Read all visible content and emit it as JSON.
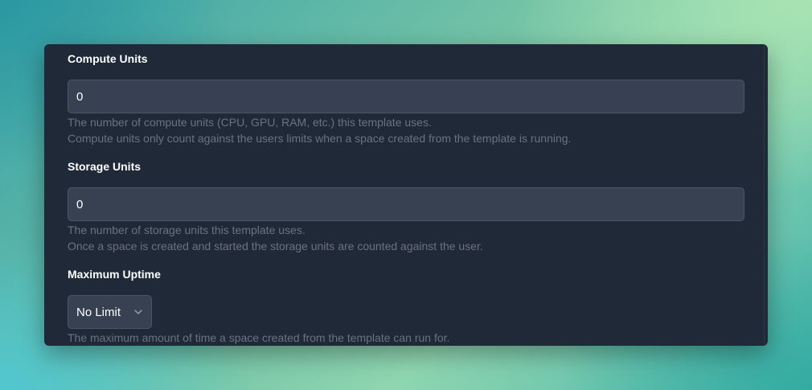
{
  "form": {
    "compute": {
      "label": "Compute Units",
      "value": "0",
      "help_line1": "The number of compute units (CPU, GPU, RAM, etc.) this template uses.",
      "help_line2": "Compute units only count against the users limits when a space created from the template is running."
    },
    "storage": {
      "label": "Storage Units",
      "value": "0",
      "help_line1": "The number of storage units this template uses.",
      "help_line2": "Once a space is created and started the storage units are counted against the user."
    },
    "uptime": {
      "label": "Maximum Uptime",
      "selected": "No Limit",
      "help": "The maximum amount of time a space created from the template can run for."
    }
  },
  "icons": {
    "select_chevron": "chevron-down-icon"
  },
  "colors": {
    "panel_bg": "#1f2937",
    "input_bg": "#374151",
    "input_border": "#4b5563",
    "label_text": "#ffffff",
    "help_text": "#6b7280"
  }
}
